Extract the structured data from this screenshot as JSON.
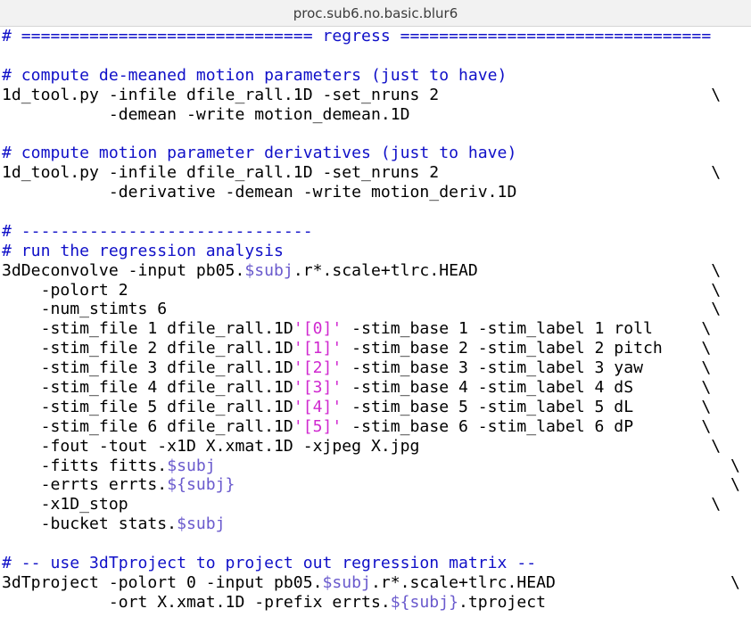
{
  "window": {
    "title": "proc.sub6.no.basic.blur6"
  },
  "code_lines": [
    [
      {
        "t": "# ============================== regress ================================",
        "c": "c"
      }
    ],
    [],
    [
      {
        "t": "# compute de-meaned motion parameters (just to have)",
        "c": "c"
      }
    ],
    [
      {
        "t": "1d_tool.py -infile dfile_rall.1D -set_nruns 2                            \\"
      }
    ],
    [
      {
        "t": "           -demean -write motion_demean.1D"
      }
    ],
    [],
    [
      {
        "t": "# compute motion parameter derivatives (just to have)",
        "c": "c"
      }
    ],
    [
      {
        "t": "1d_tool.py -infile dfile_rall.1D -set_nruns 2                            \\"
      }
    ],
    [
      {
        "t": "           -derivative -demean -write motion_deriv.1D"
      }
    ],
    [],
    [
      {
        "t": "# ------------------------------",
        "c": "c"
      }
    ],
    [
      {
        "t": "# run the regression analysis",
        "c": "c"
      }
    ],
    [
      {
        "t": "3dDeconvolve -input pb05."
      },
      {
        "t": "$subj",
        "c": "v"
      },
      {
        "t": ".r*.scale+tlrc.HEAD                        \\"
      }
    ],
    [
      {
        "t": "    -polort 2                                                            \\"
      }
    ],
    [
      {
        "t": "    -num_stimts 6                                                        \\"
      }
    ],
    [
      {
        "t": "    -stim_file 1 dfile_rall.1D"
      },
      {
        "t": "'[0]'",
        "c": "q"
      },
      {
        "t": " -stim_base 1 -stim_label 1 roll     \\"
      }
    ],
    [
      {
        "t": "    -stim_file 2 dfile_rall.1D"
      },
      {
        "t": "'[1]'",
        "c": "q"
      },
      {
        "t": " -stim_base 2 -stim_label 2 pitch    \\"
      }
    ],
    [
      {
        "t": "    -stim_file 3 dfile_rall.1D"
      },
      {
        "t": "'[2]'",
        "c": "q"
      },
      {
        "t": " -stim_base 3 -stim_label 3 yaw      \\"
      }
    ],
    [
      {
        "t": "    -stim_file 4 dfile_rall.1D"
      },
      {
        "t": "'[3]'",
        "c": "q"
      },
      {
        "t": " -stim_base 4 -stim_label 4 dS       \\"
      }
    ],
    [
      {
        "t": "    -stim_file 5 dfile_rall.1D"
      },
      {
        "t": "'[4]'",
        "c": "q"
      },
      {
        "t": " -stim_base 5 -stim_label 5 dL       \\"
      }
    ],
    [
      {
        "t": "    -stim_file 6 dfile_rall.1D"
      },
      {
        "t": "'[5]'",
        "c": "q"
      },
      {
        "t": " -stim_base 6 -stim_label 6 dP       \\"
      }
    ],
    [
      {
        "t": "    -fout -tout -x1D X.xmat.1D -xjpeg X.jpg                              \\"
      }
    ],
    [
      {
        "t": "    -fitts fitts."
      },
      {
        "t": "$subj",
        "c": "v"
      },
      {
        "t": "                                                     \\"
      }
    ],
    [
      {
        "t": "    -errts errts."
      },
      {
        "t": "${subj}",
        "c": "v"
      },
      {
        "t": "                                                   \\"
      }
    ],
    [
      {
        "t": "    -x1D_stop                                                            \\"
      }
    ],
    [
      {
        "t": "    -bucket stats."
      },
      {
        "t": "$subj",
        "c": "v"
      }
    ],
    [],
    [
      {
        "t": "# -- use 3dTproject to project out regression matrix --",
        "c": "c"
      }
    ],
    [
      {
        "t": "3dTproject -polort 0 -input pb05."
      },
      {
        "t": "$subj",
        "c": "v"
      },
      {
        "t": ".r*.scale+tlrc.HEAD                  \\"
      }
    ],
    [
      {
        "t": "           -ort X.xmat.1D -prefix errts."
      },
      {
        "t": "${subj}",
        "c": "v"
      },
      {
        "t": ".tproject"
      }
    ]
  ]
}
